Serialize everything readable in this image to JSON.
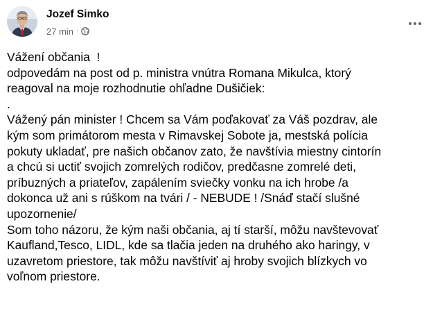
{
  "post": {
    "author": {
      "name": "Jozef Simko",
      "avatar_icon": "profile-photo"
    },
    "meta": {
      "time": "27 min",
      "separator": "·",
      "audience_icon": "globe-icon"
    },
    "more_icon": "more-options-icon",
    "body_lines": [
      "Vážení občania  !",
      "odpovedám na post od p. ministra vnútra Romana Mikulca, ktorý",
      "reagoval na moje rozhodnutie ohľadne Dušičiek:",
      ".",
      "Vážený pán minister ! Chcem sa Vám poďakovať za Váš pozdrav, ale",
      "kým som primátorom mesta v Rimavskej Sobote ja, mestská polícia",
      "pokuty ukladať, pre našich občanov zato, že navštívia miestny cintorín",
      "a chcú si uctiť svojich zomrelých rodičov, predčasne zomrelé deti,",
      "príbuzných a priateľov, zapálením sviečky vonku na ich hrobe /a",
      "dokonca už ani s rúškom na tvári / - NEBUDE ! /Snáď stačí slušné",
      "upozornenie/",
      "Som toho názoru, že kým naši občania, aj tí starší, môžu navštevovať",
      "Kaufland,Tesco, LIDL, kde sa tlačia jeden na druhého ako haringy, v",
      "uzavretom priestore, tak môžu navštíviť aj hroby svojich blízkych vo",
      "voľnom priestore."
    ]
  }
}
